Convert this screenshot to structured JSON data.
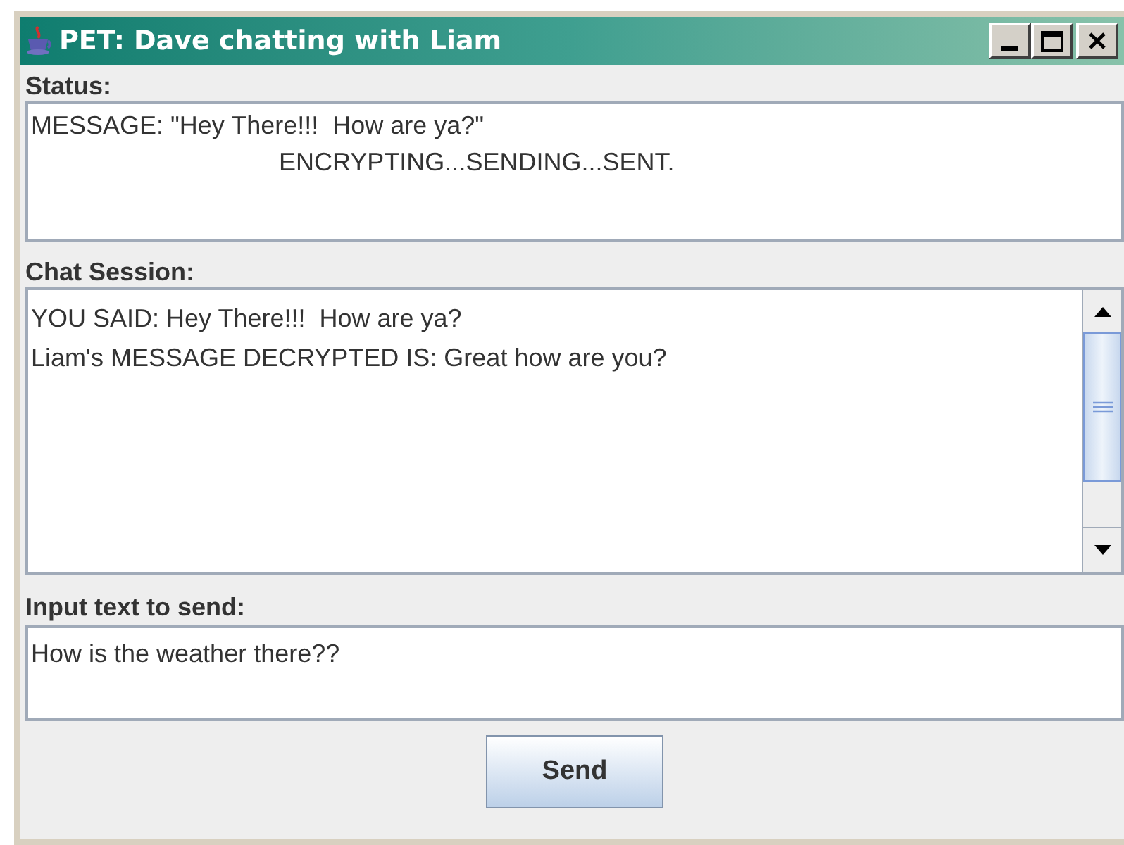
{
  "window": {
    "title": "PET: Dave chatting with Liam"
  },
  "status": {
    "label": "Status:",
    "lines": [
      "MESSAGE: \"Hey There!!!  How are ya?\"",
      "ENCRYPTING...SENDING...SENT."
    ]
  },
  "chat": {
    "label": "Chat Session:",
    "lines": [
      "YOU SAID: Hey There!!!  How are ya?",
      "Liam's MESSAGE DECRYPTED IS: Great how are you?"
    ]
  },
  "input": {
    "label": "Input text to send:",
    "value": "How is the weather there??"
  },
  "buttons": [
    "Send"
  ]
}
